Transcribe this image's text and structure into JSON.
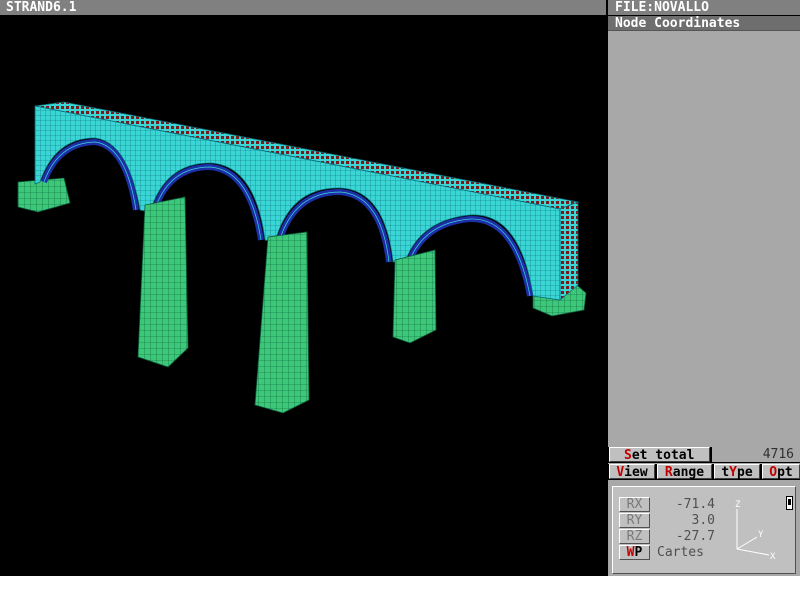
{
  "window": {
    "title": "STRAND6.1",
    "file_label": "FILE:NOVALLO"
  },
  "side_panel": {
    "header": "Node Coordinates",
    "set_total": {
      "hot": "S",
      "rest": "et total",
      "value": "4716"
    },
    "menu": [
      {
        "pre": "",
        "hot": "V",
        "post": "iew"
      },
      {
        "pre": "",
        "hot": "R",
        "post": "ange"
      },
      {
        "pre": "t",
        "hot": "Y",
        "post": "pe"
      },
      {
        "pre": "",
        "hot": "O",
        "post": "pt"
      }
    ],
    "rotation": {
      "rx_label": "RX",
      "rx_value": "-71.4",
      "ry_label": "RY",
      "ry_value": "3.0",
      "rz_label": "RZ",
      "rz_value": "-27.7",
      "wp_hot": "W",
      "wp_rest": "P",
      "wp_value": "Cartes"
    },
    "axes": {
      "z": "Z",
      "y": "Y",
      "x": "X"
    }
  },
  "colors": {
    "deck": "#3ad6d6",
    "arch": "#1d2fa8",
    "pier": "#3cc878",
    "rail": "#7a1a1a",
    "mesh_line": "#0a5a6a"
  }
}
